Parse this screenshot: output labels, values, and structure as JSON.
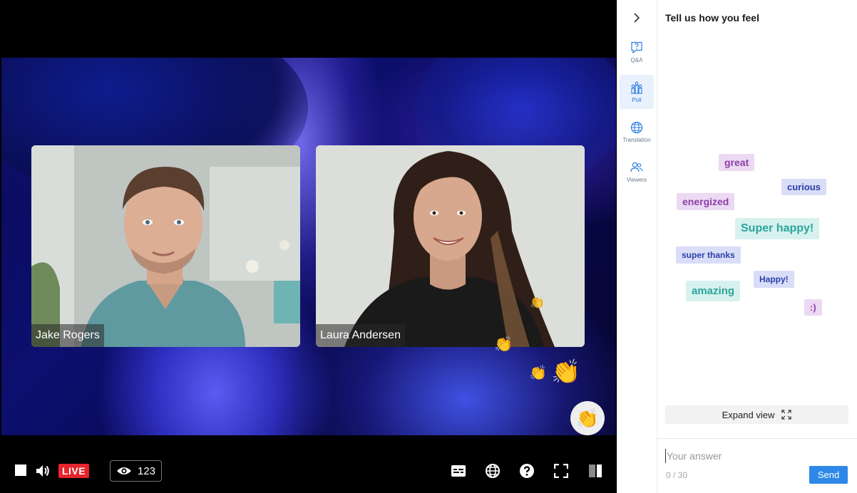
{
  "player": {
    "participants": [
      {
        "name": "Jake Rogers"
      },
      {
        "name": "Laura Andersen"
      }
    ],
    "live_label": "LIVE",
    "viewer_count": "123",
    "icons": {
      "stop": "stop-icon",
      "volume": "volume-icon",
      "eye": "eye-icon",
      "captions": "captions-icon",
      "language": "globe-icon",
      "help": "help-icon",
      "fullscreen": "fullscreen-icon",
      "layout": "layout-icon",
      "reaction": "clapping-hands-icon"
    },
    "colors": {
      "live": "#e8242c"
    }
  },
  "sidebar": {
    "collapse_icon": "chevron-right-icon",
    "items": [
      {
        "label": "Q&A",
        "icon": "qa-icon",
        "active": false
      },
      {
        "label": "Poll",
        "icon": "poll-icon",
        "active": true
      },
      {
        "label": "Translation",
        "icon": "globe-icon",
        "active": false
      },
      {
        "label": "Viewers",
        "icon": "viewers-icon",
        "active": false
      }
    ]
  },
  "poll": {
    "title": "Tell us how you feel",
    "words": [
      {
        "text": "great",
        "color": "#8e3fa6",
        "bg": "#ecd9f3"
      },
      {
        "text": "curious",
        "color": "#2c3fa8",
        "bg": "#d9ddf7"
      },
      {
        "text": "energized",
        "color": "#8e3fa6",
        "bg": "#ecd9f3"
      },
      {
        "text": "Super happy!",
        "color": "#2aa59a",
        "bg": "#d7f1ee"
      },
      {
        "text": "super thanks",
        "color": "#2c3fa8",
        "bg": "#d9ddf7"
      },
      {
        "text": "Happy!",
        "color": "#2c3fa8",
        "bg": "#d9ddf7"
      },
      {
        "text": "amazing",
        "color": "#2aa59a",
        "bg": "#d7f1ee"
      },
      {
        "text": ":)",
        "color": "#8e3fa6",
        "bg": "#ecd9f3"
      }
    ],
    "expand_label": "Expand view",
    "answer_placeholder": "Your answer",
    "counter": "0 / 30",
    "send_label": "Send"
  }
}
